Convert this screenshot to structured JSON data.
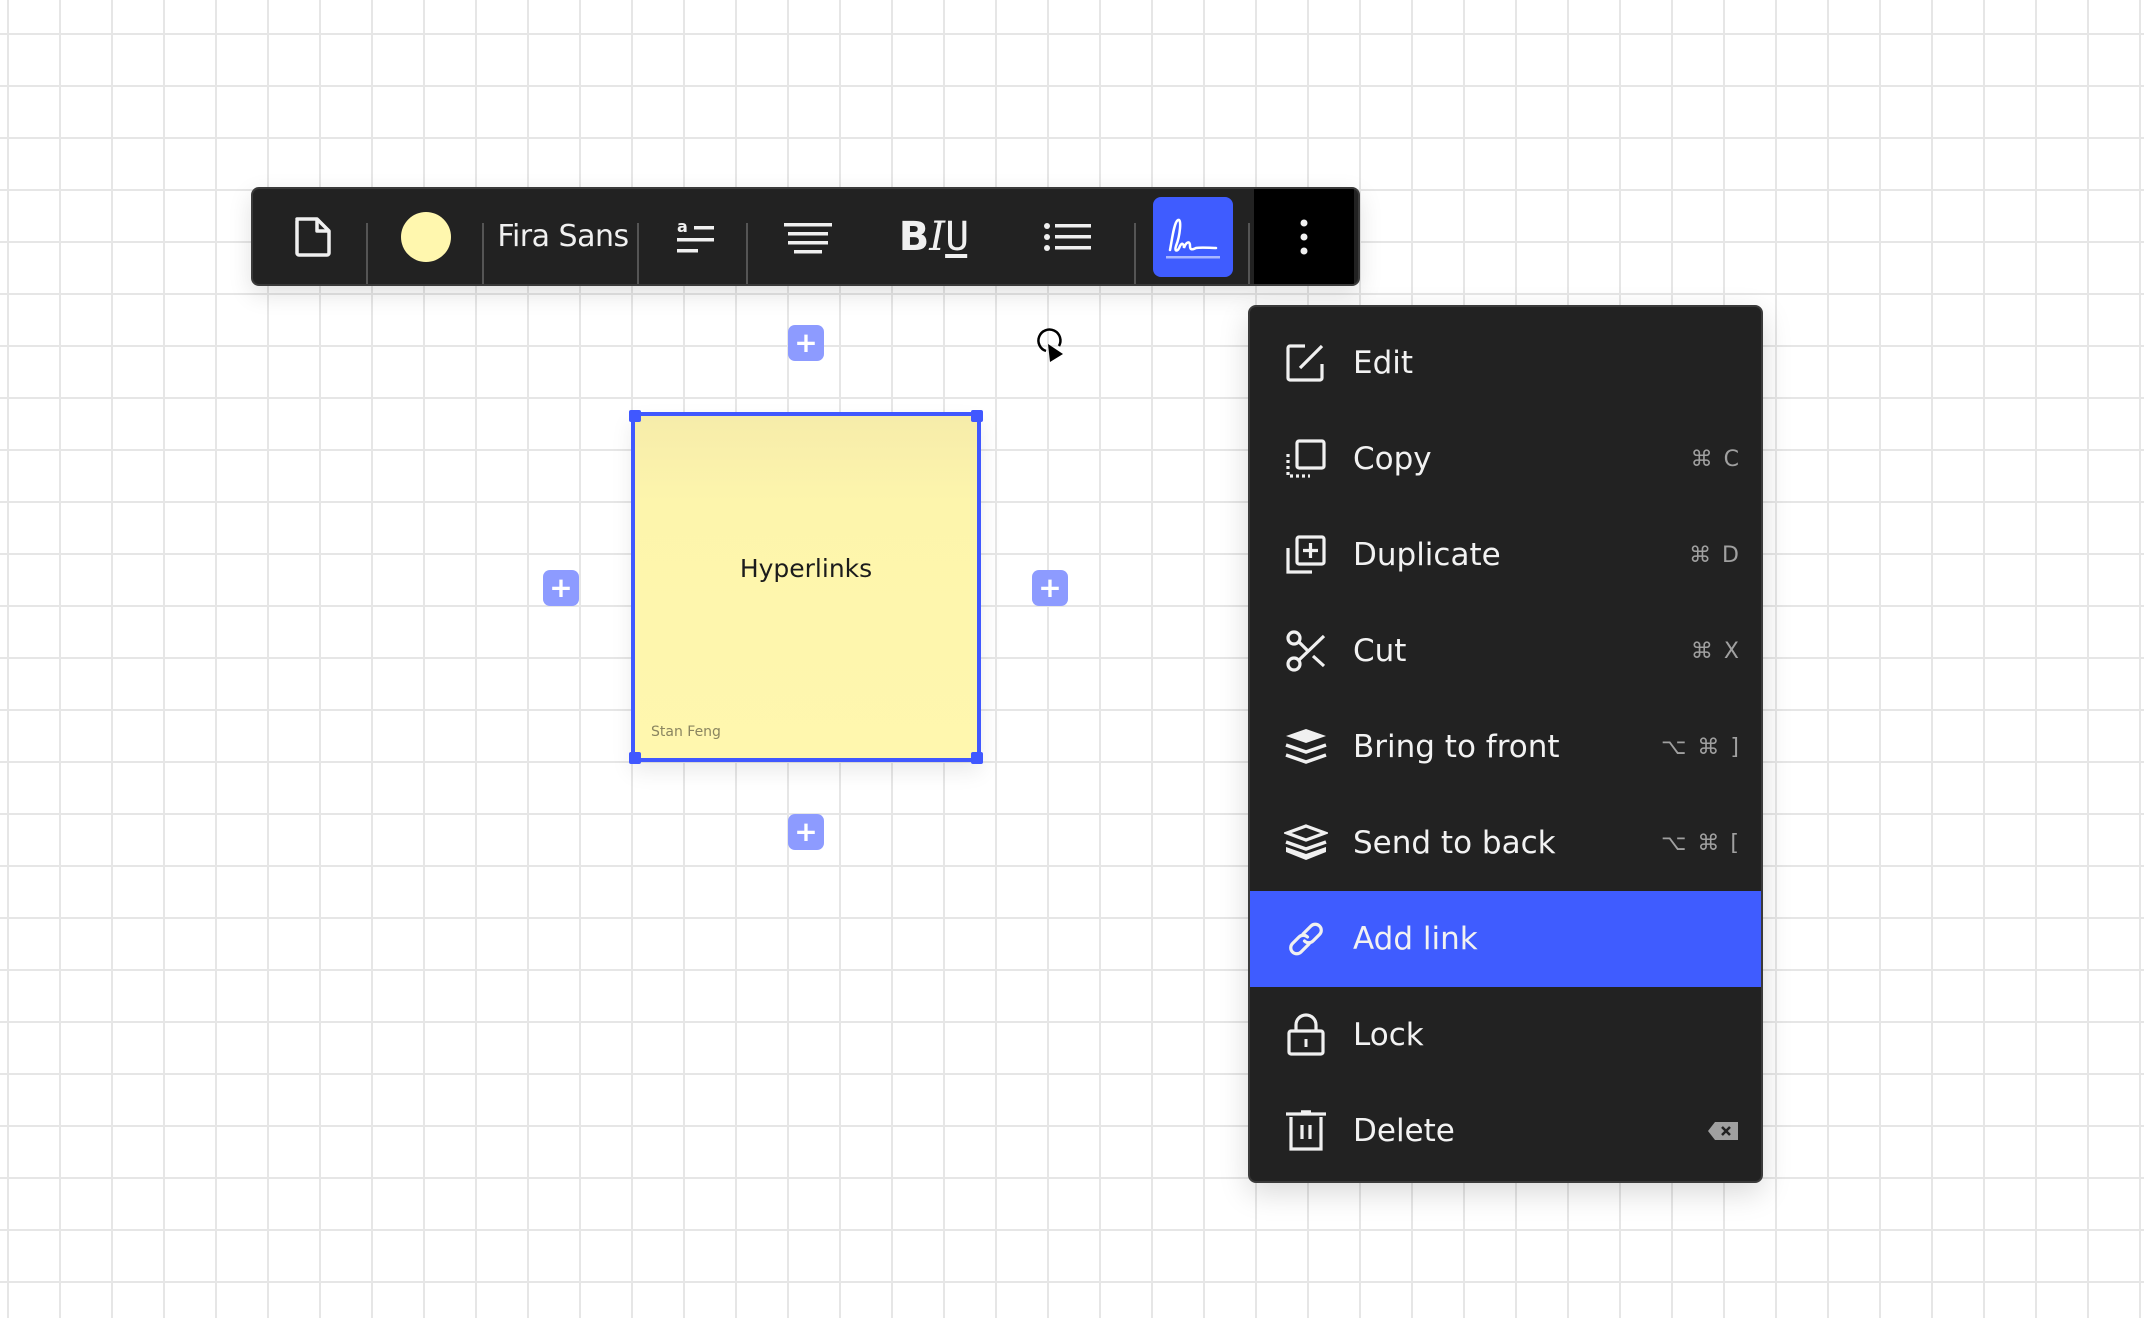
{
  "toolbar": {
    "shape_icon": "sticky-note-icon",
    "color_swatch": "#fff7ae",
    "font_family": "Fira Sans",
    "text_size_icon": "text-size-icon",
    "align_icon": "align-center-icon",
    "bold_label": "B",
    "italic_label": "I",
    "underline_label": "U",
    "list_icon": "bullet-list-icon",
    "signature_icon": "signature-icon",
    "signature_active": true,
    "more_icon": "more-vertical-icon",
    "accent_color": "#3f5cff"
  },
  "canvas": {
    "sticky": {
      "title": "Hyperlinks",
      "author": "Stan Feng",
      "color": "#fff7ae"
    },
    "plus_label": "+"
  },
  "context_menu": {
    "items": [
      {
        "label": "Edit",
        "shortcut": "",
        "icon": "edit-icon"
      },
      {
        "label": "Copy",
        "shortcut": "⌘ C",
        "icon": "copy-icon"
      },
      {
        "label": "Duplicate",
        "shortcut": "⌘ D",
        "icon": "duplicate-icon"
      },
      {
        "label": "Cut",
        "shortcut": "⌘ X",
        "icon": "scissors-icon"
      },
      {
        "label": "Bring to front",
        "shortcut": "⌥ ⌘ ]",
        "icon": "bring-to-front-icon"
      },
      {
        "label": "Send to back",
        "shortcut": "⌥ ⌘ [",
        "icon": "send-to-back-icon"
      },
      {
        "label": "Add link",
        "shortcut": "",
        "icon": "link-icon",
        "highlighted": true
      },
      {
        "label": "Lock",
        "shortcut": "",
        "icon": "lock-icon"
      },
      {
        "label": "Delete",
        "shortcut": "backspace",
        "icon": "trash-icon"
      }
    ]
  }
}
